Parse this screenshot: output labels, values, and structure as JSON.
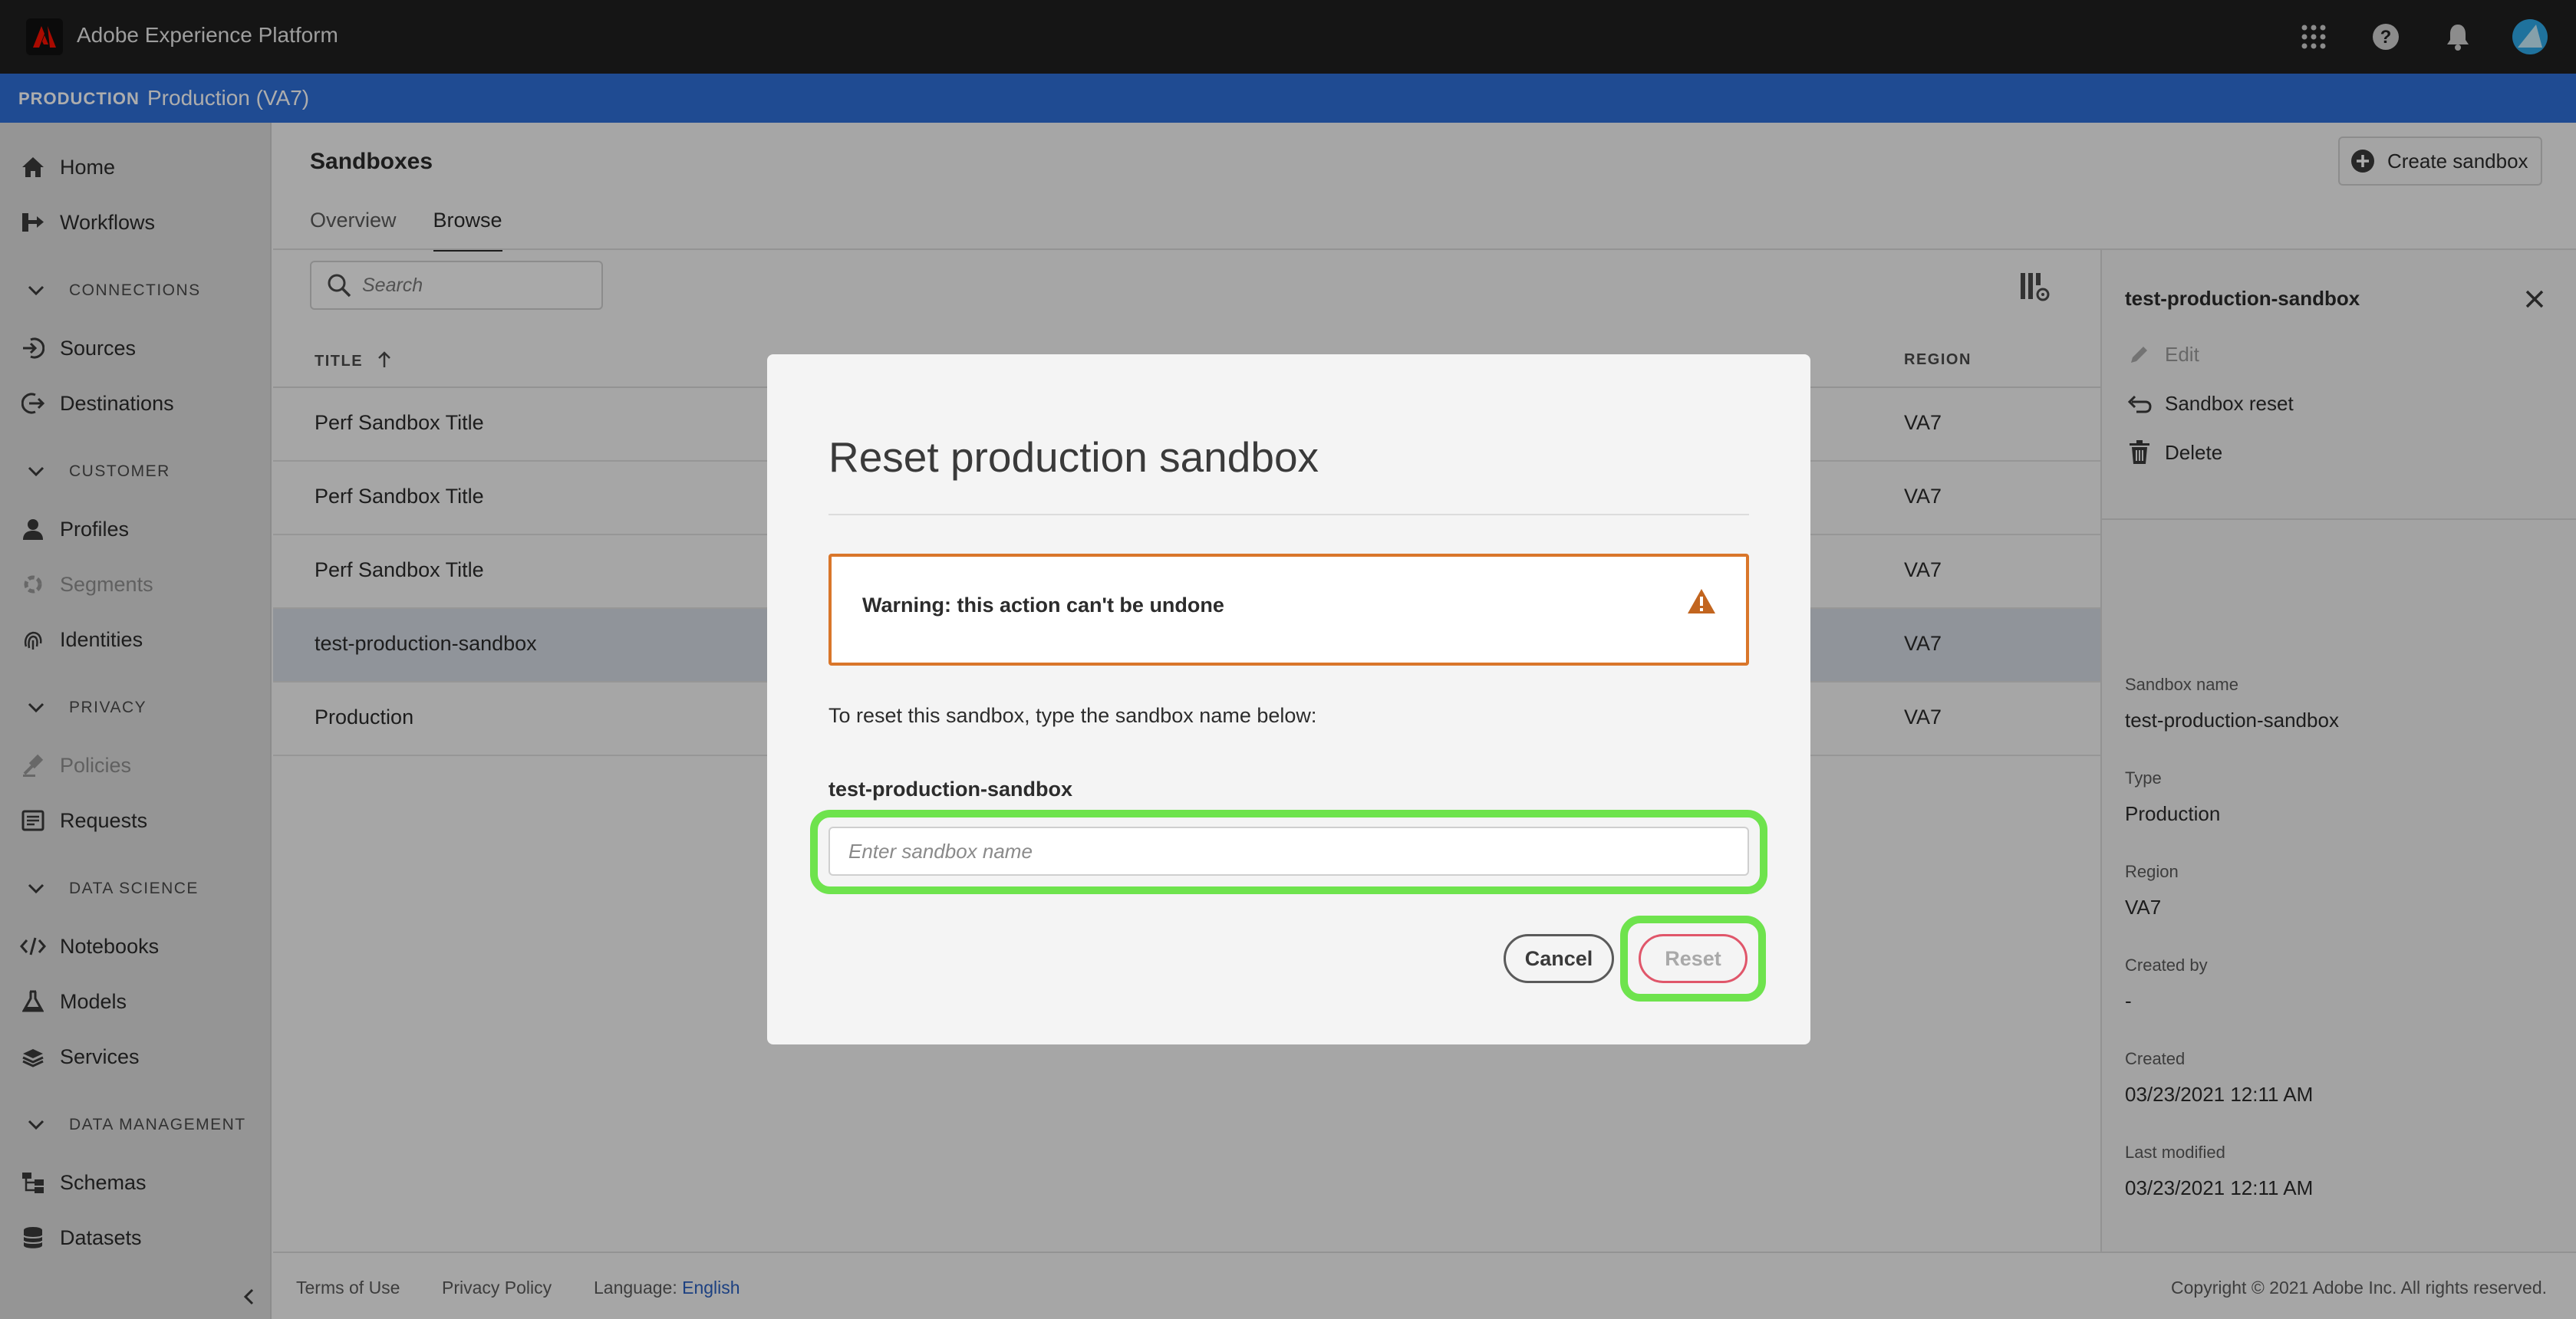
{
  "app": {
    "title": "Adobe Experience Platform"
  },
  "org": {
    "label": "PRODUCTION",
    "name": "Production (VA7)"
  },
  "sidebar": {
    "items": [
      {
        "label": "Home",
        "icon": "home-icon"
      },
      {
        "label": "Workflows",
        "icon": "workflows-icon"
      },
      {
        "label": "Sources",
        "icon": "sources-icon"
      },
      {
        "label": "Destinations",
        "icon": "destinations-icon"
      },
      {
        "label": "Profiles",
        "icon": "profiles-icon"
      },
      {
        "label": "Segments",
        "icon": "segments-icon"
      },
      {
        "label": "Identities",
        "icon": "identities-icon"
      },
      {
        "label": "Policies",
        "icon": "policies-icon"
      },
      {
        "label": "Requests",
        "icon": "requests-icon"
      },
      {
        "label": "Notebooks",
        "icon": "notebooks-icon"
      },
      {
        "label": "Models",
        "icon": "models-icon"
      },
      {
        "label": "Services",
        "icon": "services-icon"
      },
      {
        "label": "Schemas",
        "icon": "schemas-icon"
      },
      {
        "label": "Datasets",
        "icon": "datasets-icon"
      }
    ],
    "sections": {
      "connections": "CONNECTIONS",
      "customer": "CUSTOMER",
      "privacy": "PRIVACY",
      "data_science": "DATA SCIENCE",
      "data_management": "DATA MANAGEMENT"
    }
  },
  "main": {
    "title": "Sandboxes",
    "create_button": "Create sandbox",
    "tabs": [
      {
        "label": "Overview"
      },
      {
        "label": "Browse"
      }
    ],
    "search_placeholder": "Search",
    "table": {
      "columns": {
        "title": "TITLE",
        "region": "REGION"
      },
      "rows": [
        {
          "title": "Perf Sandbox Title",
          "region": "VA7"
        },
        {
          "title": "Perf Sandbox Title",
          "region": "VA7"
        },
        {
          "title": "Perf Sandbox Title",
          "region": "VA7"
        },
        {
          "title": "test-production-sandbox",
          "region": "VA7"
        },
        {
          "title": "Production",
          "region": "VA7"
        }
      ]
    }
  },
  "panel": {
    "title": "test-production-sandbox",
    "actions": {
      "edit": "Edit",
      "reset": "Sandbox reset",
      "delete": "Delete"
    },
    "fields": {
      "name_label": "Sandbox name",
      "name_value": "test-production-sandbox",
      "type_label": "Type",
      "type_value": "Production",
      "region_label": "Region",
      "region_value": "VA7",
      "created_by_label": "Created by",
      "created_by_value": "-",
      "created_label": "Created",
      "created_value": "03/23/2021 12:11 AM",
      "modified_label": "Last modified",
      "modified_value": "03/23/2021 12:11 AM"
    }
  },
  "footer": {
    "terms": "Terms of Use",
    "privacy": "Privacy Policy",
    "language_label": "Language:",
    "language_value": "English",
    "copyright": "Copyright ©  2021 Adobe Inc.  All rights reserved."
  },
  "dialog": {
    "title": "Reset production sandbox",
    "warning": "Warning: this action can't be undone",
    "instruction": "To reset this sandbox, type the sandbox name below:",
    "field_label": "test-production-sandbox",
    "input_placeholder": "Enter sandbox name",
    "cancel": "Cancel",
    "reset": "Reset"
  },
  "colors": {
    "org_bar": "#2f6fd8",
    "warning": "#d9762a",
    "highlight": "#6ee34d",
    "reset_border": "#e0566a"
  }
}
